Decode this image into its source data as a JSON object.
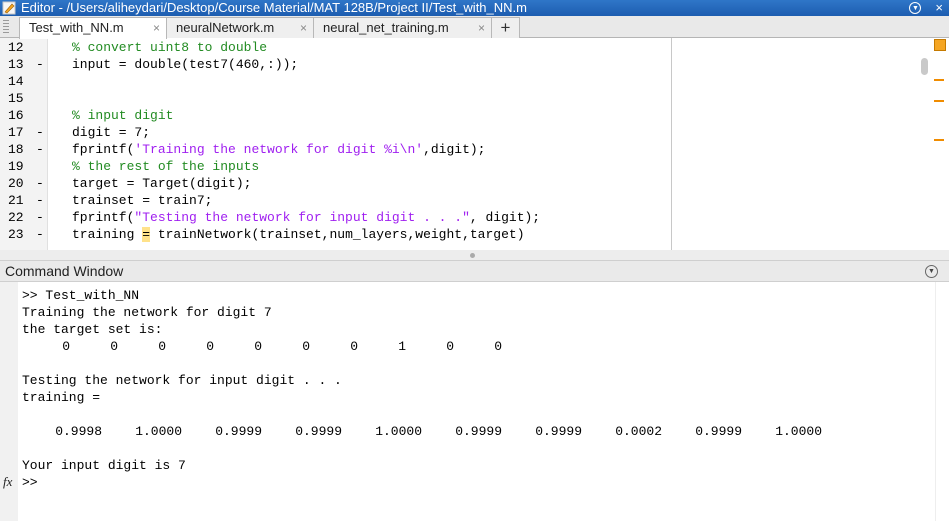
{
  "window": {
    "title": "Editor - /Users/aliheydari/Desktop/Course Material/MAT 128B/Project II/Test_with_NN.m",
    "menu_icon": "chevron-circle-icon",
    "close_label": "×"
  },
  "tabs": [
    {
      "label": "Test_with_NN.m",
      "close": "×",
      "active": true
    },
    {
      "label": "neuralNetwork.m",
      "close": "×",
      "active": false
    },
    {
      "label": "neural_net_training.m",
      "close": "×",
      "active": false
    }
  ],
  "add_tab_label": "+",
  "editor": {
    "lines": [
      {
        "num": "12",
        "dash": "",
        "segments": [
          {
            "t": "% convert uint8 to double",
            "c": "cm"
          }
        ]
      },
      {
        "num": "13",
        "dash": "-",
        "segments": [
          {
            "t": "input = double(test7(460,:));",
            "c": ""
          }
        ]
      },
      {
        "num": "14",
        "dash": "",
        "segments": []
      },
      {
        "num": "15",
        "dash": "",
        "segments": []
      },
      {
        "num": "16",
        "dash": "",
        "segments": [
          {
            "t": "% input digit",
            "c": "cm"
          }
        ]
      },
      {
        "num": "17",
        "dash": "-",
        "segments": [
          {
            "t": "digit = 7;",
            "c": ""
          }
        ]
      },
      {
        "num": "18",
        "dash": "-",
        "segments": [
          {
            "t": "fprintf(",
            "c": ""
          },
          {
            "t": "'Training the network for digit %i\\n'",
            "c": "str"
          },
          {
            "t": ",digit);",
            "c": ""
          }
        ]
      },
      {
        "num": "19",
        "dash": "",
        "segments": [
          {
            "t": "% the rest of the inputs",
            "c": "cm"
          }
        ]
      },
      {
        "num": "20",
        "dash": "-",
        "segments": [
          {
            "t": "target = Target(digit);",
            "c": ""
          }
        ]
      },
      {
        "num": "21",
        "dash": "-",
        "segments": [
          {
            "t": "trainset = train7;",
            "c": ""
          }
        ]
      },
      {
        "num": "22",
        "dash": "-",
        "segments": [
          {
            "t": "fprintf(",
            "c": ""
          },
          {
            "t": "\"Testing the network for input digit . . .\"",
            "c": "str"
          },
          {
            "t": ", digit);",
            "c": ""
          }
        ]
      },
      {
        "num": "23",
        "dash": "-",
        "segments": [
          {
            "t": "training ",
            "c": ""
          },
          {
            "t": "=",
            "c": "hl"
          },
          {
            "t": " trainNetwork(trainset,num_layers,weight,target)",
            "c": ""
          }
        ]
      }
    ]
  },
  "command_window": {
    "title": "Command Window",
    "menu_icon": "chevron-circle-icon",
    "lines": [
      ">> Test_with_NN",
      "Training the network for digit 7",
      "the target set is:"
    ],
    "target_values": [
      "0",
      "0",
      "0",
      "0",
      "0",
      "0",
      "0",
      "1",
      "0",
      "0"
    ],
    "testing_line": "Testing the network for input digit . . .",
    "training_label": "training =",
    "training_values": [
      "0.9998",
      "1.0000",
      "0.9999",
      "0.9999",
      "1.0000",
      "0.9999",
      "0.9999",
      "0.0002",
      "0.9999",
      "1.0000"
    ],
    "result_line": "Your input digit is 7",
    "prompt": ">>",
    "fx_label": "fx"
  }
}
